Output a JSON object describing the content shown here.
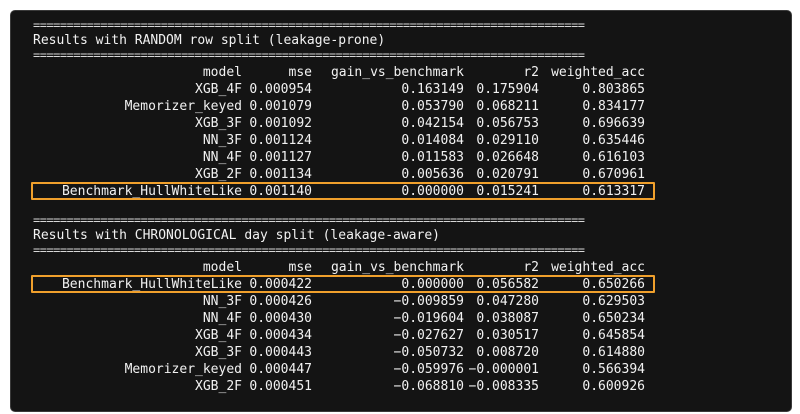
{
  "separator": "==================================================================================",
  "sections": [
    {
      "title": "Results with RANDOM row split (leakage-prone)",
      "header": {
        "model": "model",
        "mse": "mse",
        "gain": "gain_vs_benchmark",
        "r2": "r2",
        "wacc": "weighted_acc"
      },
      "rows": [
        {
          "model": "XGB_4F",
          "mse": "0.000954",
          "gain": "0.163149",
          "r2": "0.175904",
          "wacc": "0.803865"
        },
        {
          "model": "Memorizer_keyed",
          "mse": "0.001079",
          "gain": "0.053790",
          "r2": "0.068211",
          "wacc": "0.834177"
        },
        {
          "model": "XGB_3F",
          "mse": "0.001092",
          "gain": "0.042154",
          "r2": "0.056753",
          "wacc": "0.696639"
        },
        {
          "model": "NN_3F",
          "mse": "0.001124",
          "gain": "0.014084",
          "r2": "0.029110",
          "wacc": "0.635446"
        },
        {
          "model": "NN_4F",
          "mse": "0.001127",
          "gain": "0.011583",
          "r2": "0.026648",
          "wacc": "0.616103"
        },
        {
          "model": "XGB_2F",
          "mse": "0.001134",
          "gain": "0.005636",
          "r2": "0.020791",
          "wacc": "0.670961"
        },
        {
          "model": "Benchmark_HullWhiteLike",
          "mse": "0.001140",
          "gain": "0.000000",
          "r2": "0.015241",
          "wacc": "0.613317"
        }
      ]
    },
    {
      "title": "Results with CHRONOLOGICAL day split (leakage-aware)",
      "header": {
        "model": "model",
        "mse": "mse",
        "gain": "gain_vs_benchmark",
        "r2": "r2",
        "wacc": "weighted_acc"
      },
      "rows": [
        {
          "model": "Benchmark_HullWhiteLike",
          "mse": "0.000422",
          "gain": "0.000000",
          "r2": "0.056582",
          "wacc": "0.650266"
        },
        {
          "model": "NN_3F",
          "mse": "0.000426",
          "gain": "−0.009859",
          "r2": "0.047280",
          "wacc": "0.629503"
        },
        {
          "model": "NN_4F",
          "mse": "0.000430",
          "gain": "−0.019604",
          "r2": "0.038087",
          "wacc": "0.650234"
        },
        {
          "model": "XGB_4F",
          "mse": "0.000434",
          "gain": "−0.027627",
          "r2": "0.030517",
          "wacc": "0.645854"
        },
        {
          "model": "XGB_3F",
          "mse": "0.000443",
          "gain": "−0.050732",
          "r2": "0.008720",
          "wacc": "0.614880"
        },
        {
          "model": "Memorizer_keyed",
          "mse": "0.000447",
          "gain": "−0.059976",
          "r2": "−0.000001",
          "wacc": "0.566394"
        },
        {
          "model": "XGB_2F",
          "mse": "0.000451",
          "gain": "−0.068810",
          "r2": "−0.008335",
          "wacc": "0.600926"
        }
      ]
    }
  ],
  "highlight_color": "#f0a02c"
}
